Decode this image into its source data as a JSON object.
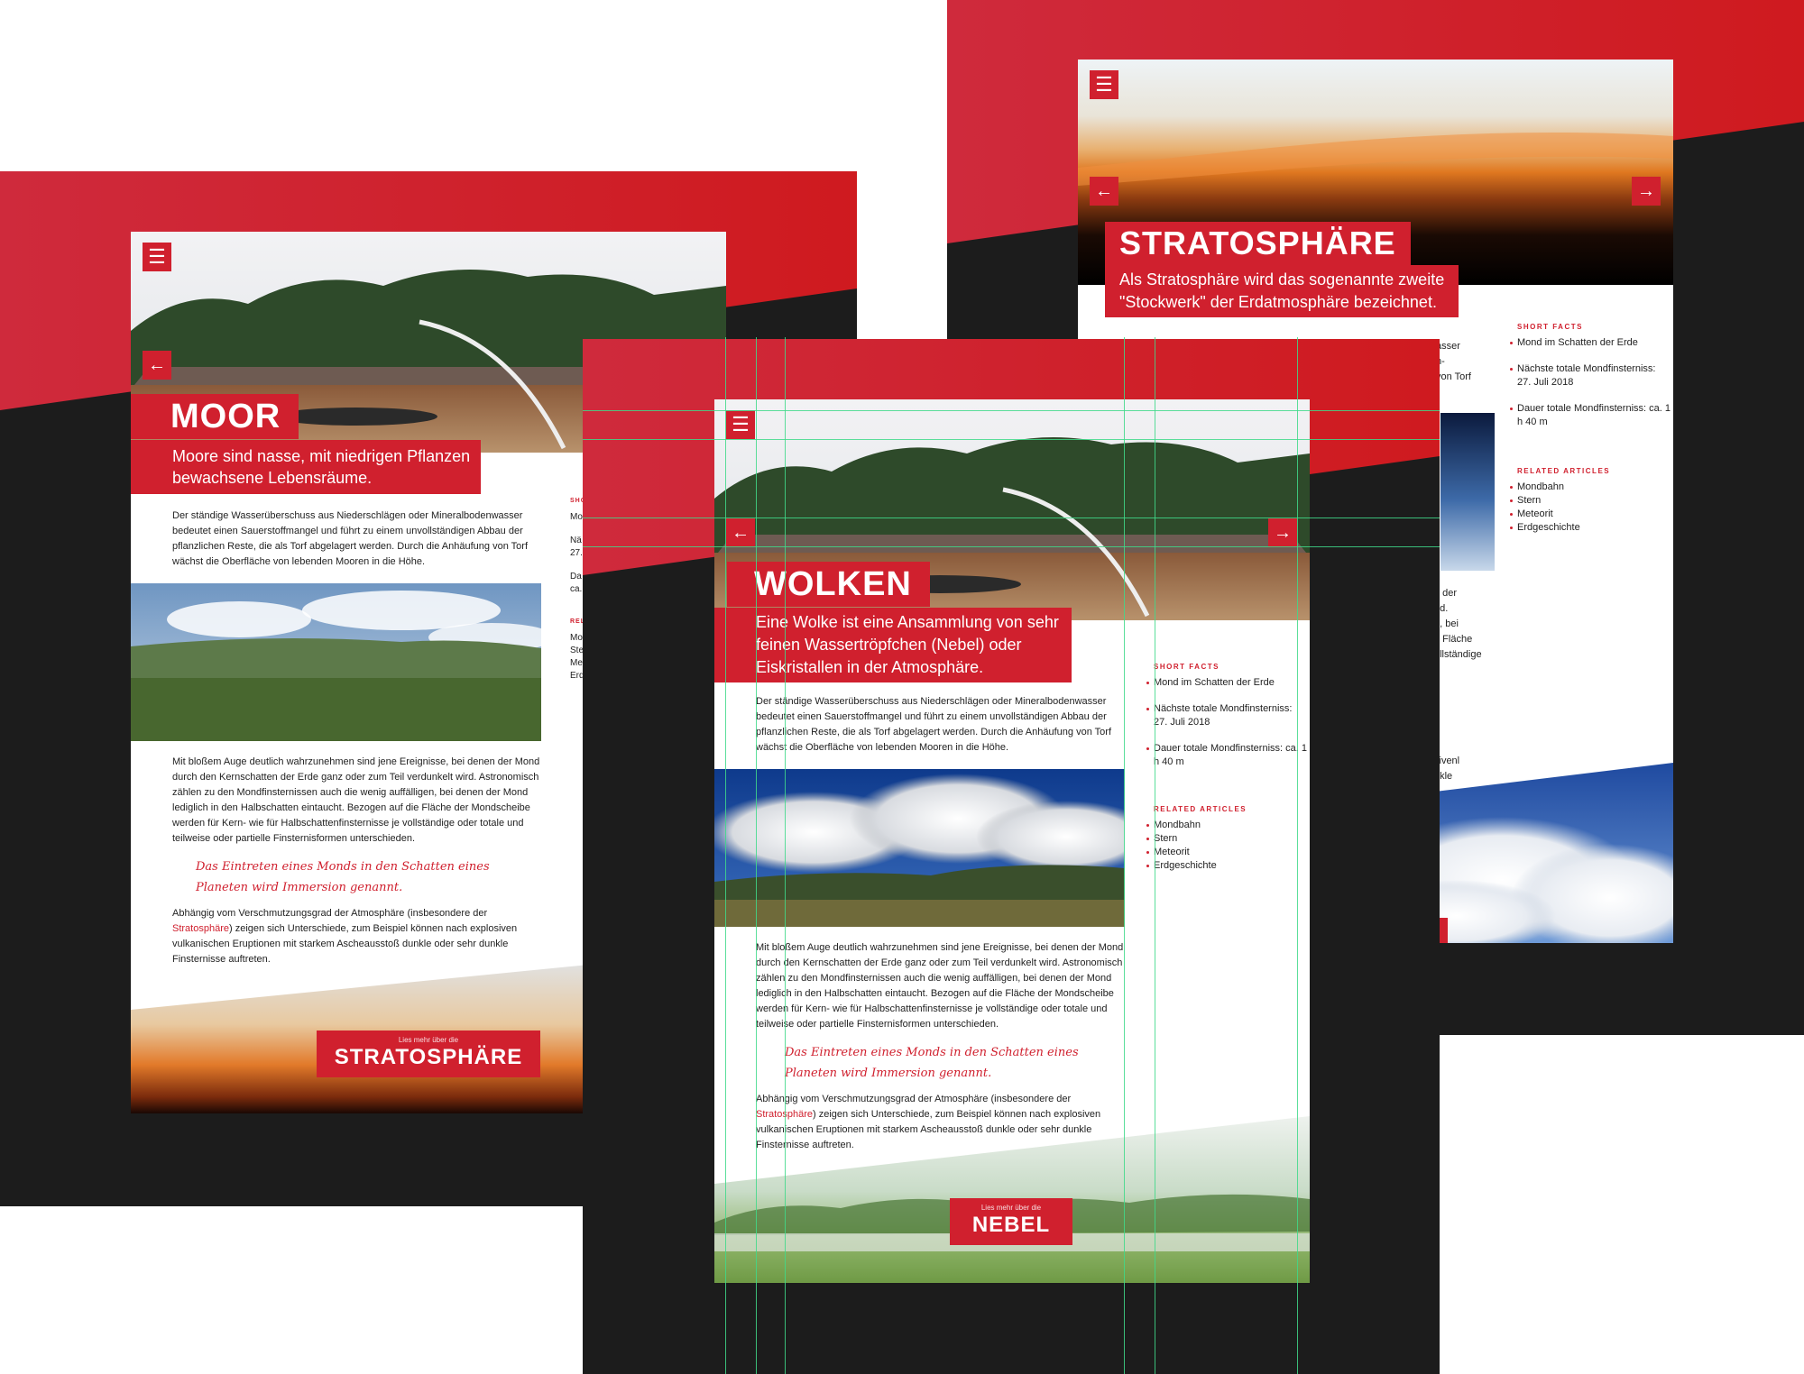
{
  "colors": {
    "brand": "#d0202e",
    "dark": "#1c1c1c",
    "guides": "#3fd98a"
  },
  "icons": {
    "menu": "☰",
    "prev": "←",
    "next": "→"
  },
  "stratosphere_page": {
    "title": "STRATOSPHÄRE",
    "subtitle": [
      "Als Stratosphäre wird das sogenannte zweite",
      "\"Stockwerk\" der Erdatmosphäre bezeichnet."
    ],
    "short_facts_title": "SHORT FACTS",
    "short_facts": [
      "Mond im Schatten der Erde",
      "Nächste totale Mondfinsterniss: 27. Juli 2018",
      "Dauer totale Mondfinsterniss: ca. 1 h 40 m"
    ],
    "related_title": "RELATED ARTICLES",
    "related": [
      "Mondbahn",
      "Stern",
      "Meteorit",
      "Erdgeschichte"
    ],
    "fragments_top": [
      "asser",
      "n-",
      "von Torf"
    ],
    "fragments_mid": [
      "n der",
      "ird.",
      "n, bei",
      "e Fläche",
      "ollständige"
    ],
    "fragments_bottom": [
      "sivenl",
      "nkle"
    ]
  },
  "moor_page": {
    "title": "MOOR",
    "subtitle": [
      "Moore sind nasse, mit niedrigen Pflanzen",
      "bewachsene Lebensräume."
    ],
    "paragraph1": "Der ständige Wasserüberschuss aus Niederschlägen oder Mineralbodenwasser bedeutet einen Sauerstoffmangel und führt zu einem unvollständigen Abbau der pflanzlichen Reste, die als Torf abgelagert werden. Durch die Anhäufung von Torf wächst die Oberfläche von lebenden Mooren in die Höhe.",
    "paragraph2": "Mit bloßem Auge deutlich wahrzunehmen sind jene Ereignisse, bei denen der Mond durch den Kernschatten der Erde ganz oder zum Teil verdunkelt wird. Astronomisch zählen zu den Mondfinsternissen auch die wenig auffälligen, bei denen der Mond lediglich in den Halbschatten eintaucht. Bezogen auf die Fläche der Mondscheibe werden für Kern- wie für Halbschattenfinsternisse je vollständige oder totale und teilweise oder partielle Finsternisformen unterschieden.",
    "quote": [
      "Das Eintreten eines Monds in den Schatten eines",
      "Planeten wird Immersion genannt."
    ],
    "paragraph3_before": "Abhängig vom Verschmutzungsgrad der Atmosphäre (insbesondere der ",
    "paragraph3_link": "Stratosphäre",
    "paragraph3_after": ") zeigen sich Unterschiede, zum Beispiel können nach explosiven vulkanischen Eruptionen mit starkem Ascheausstoß dunkle oder sehr dunkle Finsternisse auftreten.",
    "side_fragments": [
      "SHO",
      "Mo",
      "Nä",
      "27.",
      "Da",
      "ca.",
      "REL",
      "Mo",
      "Ste",
      "Me",
      "Erd"
    ],
    "cta_small": "Lies mehr über die",
    "cta_big": "STRATOSPHÄRE"
  },
  "wolken_page": {
    "title": "WOLKEN",
    "subtitle": [
      "Eine Wolke ist eine Ansammlung von sehr",
      "feinen Wassertröpfchen (Nebel) oder",
      "Eiskristallen in der Atmosphäre."
    ],
    "paragraph1": "Der ständige Wasserüberschuss aus Niederschlägen oder Mineralbodenwasser bedeutet einen Sauerstoffmangel und führt zu einem unvollständigen Abbau der pflanzlichen Reste, die als Torf abgelagert werden. Durch die Anhäufung von Torf wächst die Oberfläche von lebenden Mooren in die Höhe.",
    "paragraph2": "Mit bloßem Auge deutlich wahrzunehmen sind jene Ereignisse, bei denen der Mond durch den Kernschatten der Erde ganz oder zum Teil verdunkelt wird. Astronomisch zählen zu den Mondfinsternissen auch die wenig auffälligen, bei denen der Mond lediglich in den Halbschatten eintaucht. Bezogen auf die Fläche der Mondscheibe werden für Kern- wie für Halbschattenfinsternisse je vollständige oder totale und teilweise oder partielle Finsternisformen unterschieden.",
    "quote": [
      "Das Eintreten eines Monds in den Schatten eines",
      "Planeten wird Immersion genannt."
    ],
    "paragraph3_before": "Abhängig vom Verschmutzungsgrad der Atmosphäre (insbesondere der ",
    "paragraph3_link": "Stratosphäre",
    "paragraph3_after": ") zeigen sich Unterschiede, zum Beispiel können nach explosiven vulkanischen Eruptionen mit starkem Ascheausstoß dunkle oder sehr dunkle Finsternisse auftreten.",
    "short_facts_title": "SHORT FACTS",
    "short_facts": [
      "Mond im Schatten der Erde",
      "Nächste totale Mondfinsterniss: 27. Juli 2018",
      "Dauer totale Mondfinsterniss: ca. 1 h 40 m"
    ],
    "related_title": "RELATED ARTICLES",
    "related": [
      "Mondbahn",
      "Stern",
      "Meteorit",
      "Erdgeschichte"
    ],
    "cta_small": "Lies mehr über die",
    "cta_big": "NEBEL"
  }
}
